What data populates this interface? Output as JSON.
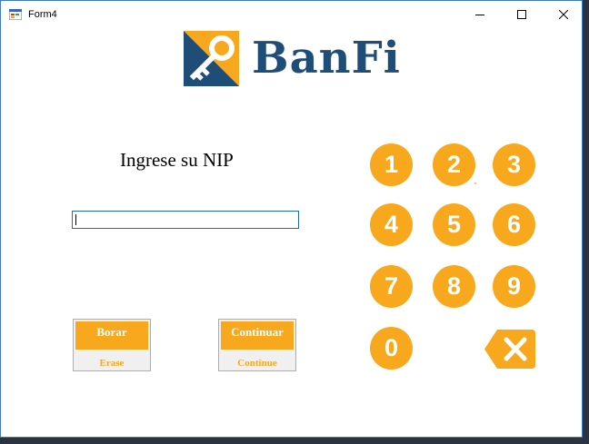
{
  "window": {
    "title": "Form4"
  },
  "brand": {
    "name": "BanFi"
  },
  "prompt": "Ingrese su NIP",
  "pin_input": {
    "value": ""
  },
  "actions": {
    "erase": {
      "label": "Borar",
      "sublabel": "Erase"
    },
    "continue": {
      "label": "Continuar",
      "sublabel": "Continue"
    }
  },
  "keypad": {
    "keys": [
      "1",
      "2",
      "3",
      "4",
      "5",
      "6",
      "7",
      "8",
      "9",
      "0"
    ]
  },
  "icons": [
    "app-form-icon",
    "minimize-icon",
    "maximize-icon",
    "close-icon",
    "key-logo-icon",
    "backspace-icon"
  ],
  "colors": {
    "accent": "#f8a81c",
    "brand": "#1e4e78"
  }
}
